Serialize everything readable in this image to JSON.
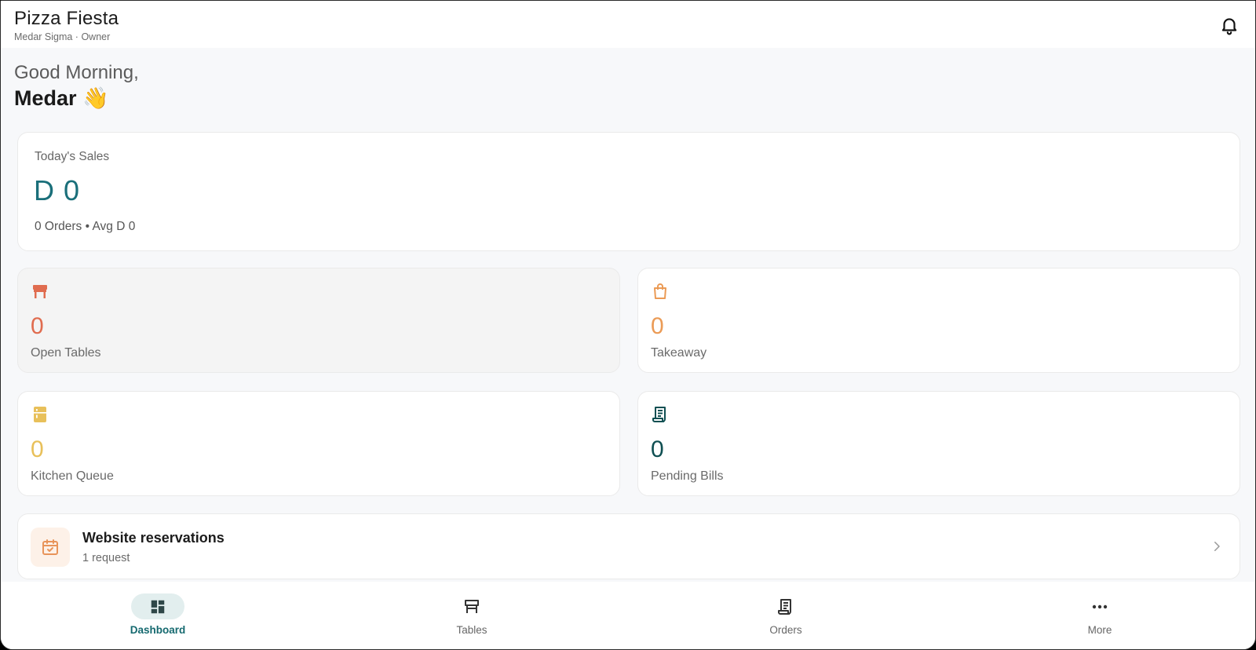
{
  "header": {
    "title": "Pizza Fiesta",
    "subtitle": "Medar Sigma · Owner",
    "notification_icon": "bell-icon"
  },
  "greeting": {
    "line1": "Good Morning,",
    "name": "Medar",
    "emoji": "👋"
  },
  "sales": {
    "label": "Today's Sales",
    "value": "D 0",
    "meta": "0 Orders • Avg D 0",
    "accent": "#1a6f7a"
  },
  "stats": [
    {
      "label": "Open Tables",
      "value": "0",
      "icon": "table-icon",
      "color": "#e06c4f"
    },
    {
      "label": "Takeaway",
      "value": "0",
      "icon": "shopping-bag-icon",
      "color": "#eb9b56"
    },
    {
      "label": "Kitchen Queue",
      "value": "0",
      "icon": "kitchen-icon",
      "color": "#e8c05a"
    },
    {
      "label": "Pending Bills",
      "value": "0",
      "icon": "receipt-icon",
      "color": "#0f4f52"
    }
  ],
  "reservations": {
    "title": "Website reservations",
    "subtitle": "1 request",
    "icon": "calendar-check-icon"
  },
  "nav": [
    {
      "label": "Dashboard",
      "icon": "dashboard-icon",
      "active": true
    },
    {
      "label": "Tables",
      "icon": "table-icon",
      "active": false
    },
    {
      "label": "Orders",
      "icon": "receipt-icon",
      "active": false
    },
    {
      "label": "More",
      "icon": "more-dots-icon",
      "active": false
    }
  ]
}
